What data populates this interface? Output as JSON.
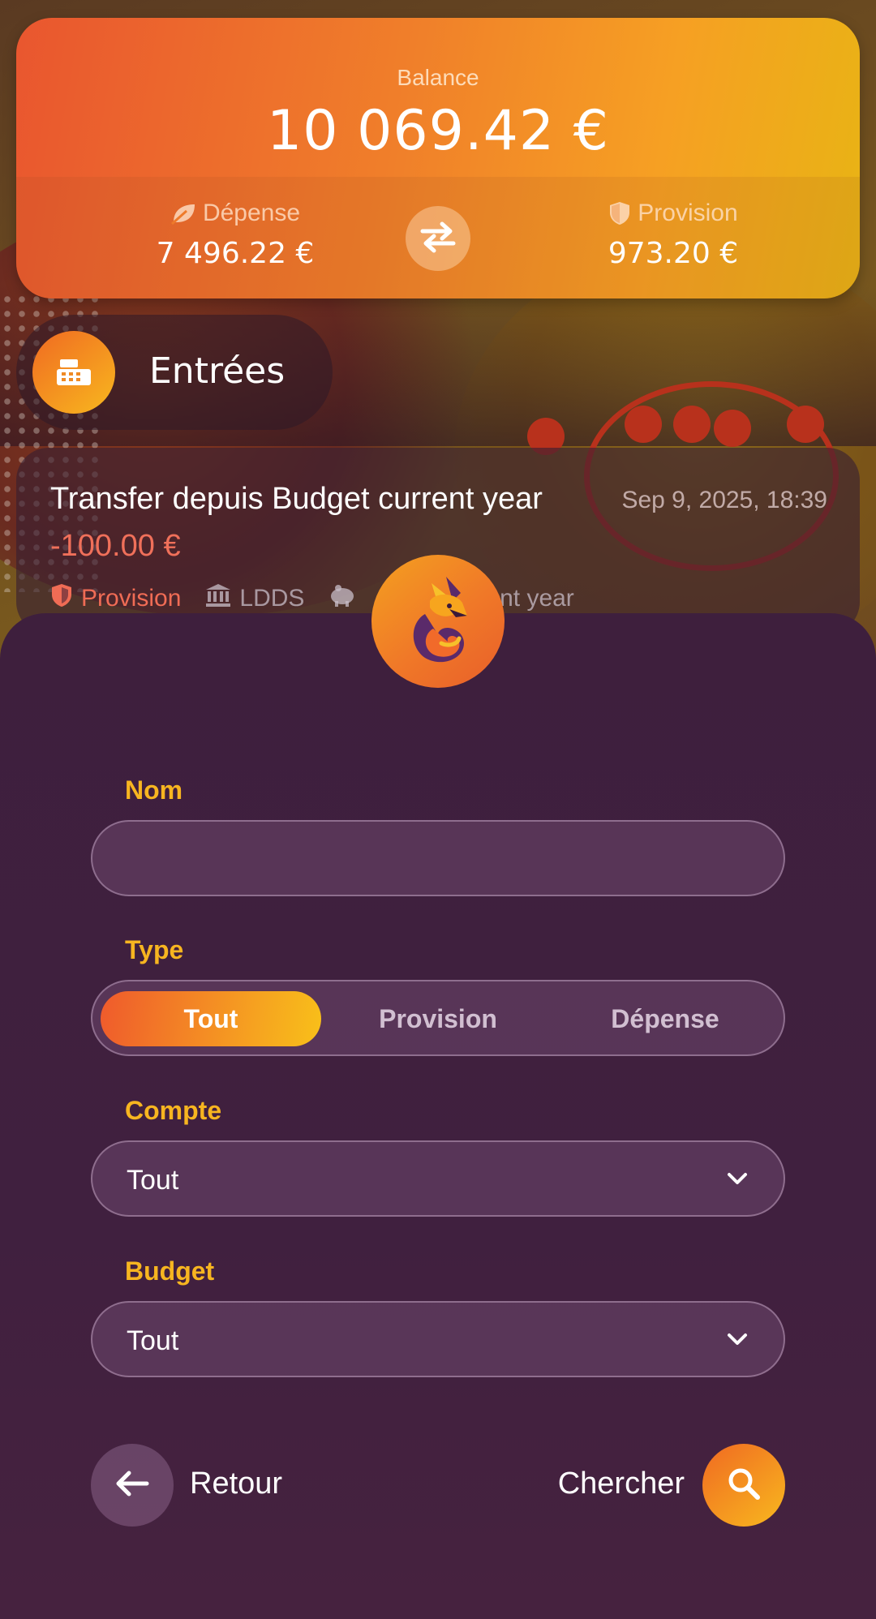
{
  "balance": {
    "label": "Balance",
    "amount": "10 069.42 €"
  },
  "stats": {
    "depense": {
      "label": "Dépense",
      "value": "7 496.22 €",
      "icon": "leaf-icon"
    },
    "provision": {
      "label": "Provision",
      "value": "973.20 €",
      "icon": "shield-icon"
    },
    "swap_icon": "swap-arrows-icon"
  },
  "section": {
    "title": "Entrées",
    "icon": "cash-register-icon"
  },
  "transaction": {
    "title": "Transfer depuis Budget current year",
    "date": "Sep 9, 2025, 18:39",
    "amount": "-100.00 €",
    "tags": {
      "type": "Provision",
      "account": "LDDS",
      "budget": "rrent year"
    }
  },
  "search": {
    "name_label": "Nom",
    "name_value": "",
    "type_label": "Type",
    "type_options": [
      "Tout",
      "Provision",
      "Dépense"
    ],
    "type_selected": "Tout",
    "account_label": "Compte",
    "account_value": "Tout",
    "budget_label": "Budget",
    "budget_value": "Tout",
    "back_label": "Retour",
    "search_label": "Chercher"
  },
  "colors": {
    "accent_orange": "#f07828",
    "accent_yellow": "#f7b520",
    "negative_amount": "#f0705a",
    "sheet_background": "#40203f"
  }
}
